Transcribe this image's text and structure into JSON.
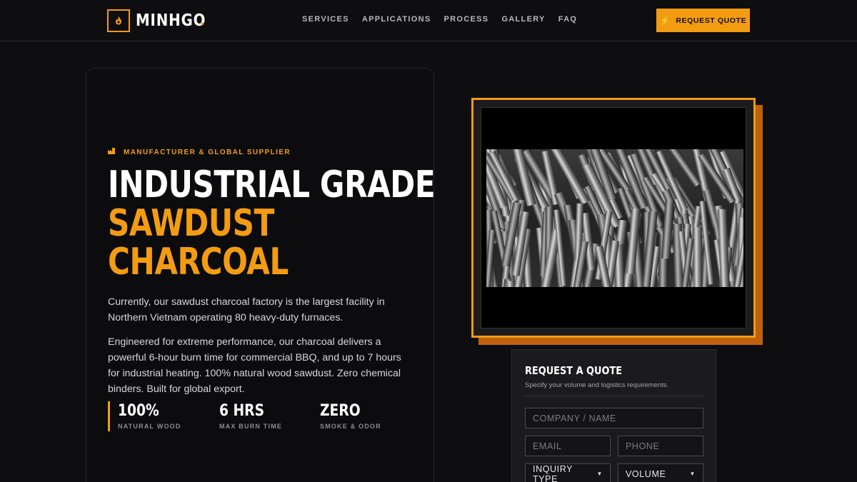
{
  "brand": {
    "name": "MINHGO",
    "dot": ".",
    "accent": "#f39c12"
  },
  "nav": {
    "items": [
      "SERVICES",
      "APPLICATIONS",
      "PROCESS",
      "GALLERY",
      "FAQ"
    ],
    "cta_label": "REQUEST QUOTE"
  },
  "hero": {
    "eyebrow": "MANUFACTURER & GLOBAL SUPPLIER",
    "headline_line1": "INDUSTRIAL GRADE",
    "headline_line2": "SAWDUST",
    "headline_line3": "CHARCOAL",
    "paragraph1": "Currently, our sawdust charcoal factory is the largest facility in Northern Vietnam operating 80 heavy-duty furnaces.",
    "paragraph2": "Engineered for extreme performance, our charcoal delivers a powerful 6-hour burn time for commercial BBQ, and up to 7 hours for industrial heating. 100% natural wood sawdust. Zero chemical binders. Built for global export.",
    "stats": [
      {
        "value": "100%",
        "label": "NATURAL WOOD"
      },
      {
        "value": "6 HRS",
        "label": "MAX BURN TIME"
      },
      {
        "value": "ZERO",
        "label": "SMOKE & ODOR"
      }
    ]
  },
  "quote_form": {
    "title": "REQUEST A QUOTE",
    "subtitle": "Specify your volume and logistics requirements.",
    "company_placeholder": "COMPANY / NAME",
    "email_placeholder": "EMAIL",
    "phone_placeholder": "PHONE",
    "inquiry_type": "INQUIRY TYPE",
    "volume": "VOLUME"
  },
  "icons": {
    "logo": "flame-icon",
    "cta": "bolt-icon",
    "eyebrow": "factory-icon",
    "select": "chevron-down-icon"
  }
}
